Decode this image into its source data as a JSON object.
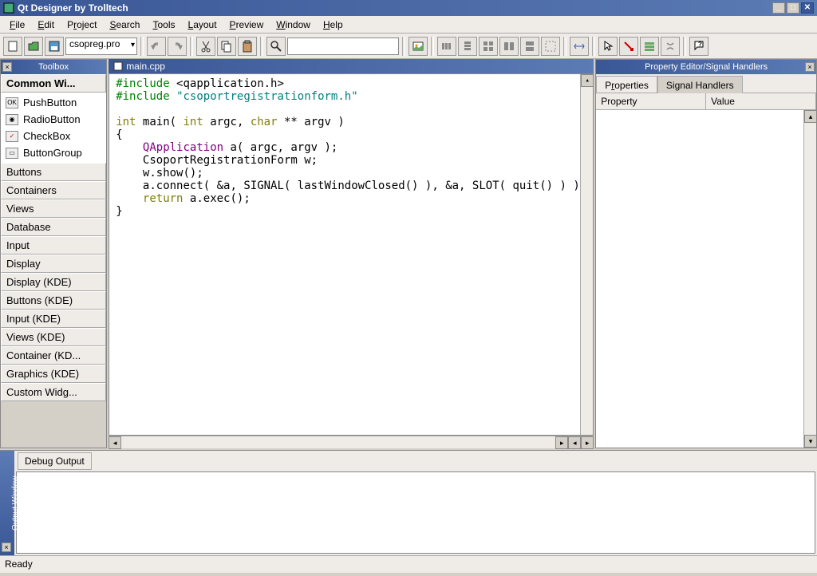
{
  "window": {
    "title": "Qt Designer by Trolltech"
  },
  "menu": {
    "file": "File",
    "edit": "Edit",
    "project": "Project",
    "search": "Search",
    "tools": "Tools",
    "layout": "Layout",
    "preview": "Preview",
    "window": "Window",
    "help": "Help"
  },
  "toolbar": {
    "project_combo": "csopreg.pro"
  },
  "toolbox": {
    "title": "Toolbox",
    "active_section": "Common Wi...",
    "items": [
      {
        "label": "PushButton",
        "icon": "ok"
      },
      {
        "label": "RadioButton",
        "icon": "radio"
      },
      {
        "label": "CheckBox",
        "icon": "check"
      },
      {
        "label": "ButtonGroup",
        "icon": "group"
      }
    ],
    "sections": [
      "Buttons",
      "Containers",
      "Views",
      "Database",
      "Input",
      "Display",
      "Display (KDE)",
      "Buttons (KDE)",
      "Input (KDE)",
      "Views (KDE)",
      "Container (KD...",
      "Graphics (KDE)",
      "Custom Widg..."
    ]
  },
  "editor": {
    "tab_title": "main.cpp",
    "code_lines": [
      {
        "t": "#include",
        "c": "kw-green",
        "r": " <qapplication.h>"
      },
      {
        "t": "#include",
        "c": "kw-green",
        "r": " ",
        "s": "\"csoportregistrationform.h\"",
        "sc": "str-teal"
      },
      {
        "blank": true
      },
      {
        "parts": [
          {
            "t": "int",
            "c": "kw-olive"
          },
          {
            "t": " main( "
          },
          {
            "t": "int",
            "c": "kw-olive"
          },
          {
            "t": " argc, "
          },
          {
            "t": "char",
            "c": "kw-olive"
          },
          {
            "t": " ** argv )"
          }
        ]
      },
      {
        "t": "{"
      },
      {
        "parts": [
          {
            "t": "    "
          },
          {
            "t": "QApplication",
            "c": "kw-purple"
          },
          {
            "t": " a( argc, argv );"
          }
        ]
      },
      {
        "t": "    CsoportRegistrationForm w;"
      },
      {
        "t": "    w.show();"
      },
      {
        "t": "    a.connect( &a, SIGNAL( lastWindowClosed() ), &a, SLOT( quit() ) );"
      },
      {
        "parts": [
          {
            "t": "    "
          },
          {
            "t": "return",
            "c": "kw-olive"
          },
          {
            "t": " a.exec();"
          }
        ]
      },
      {
        "t": "}"
      }
    ]
  },
  "properties": {
    "title": "Property Editor/Signal Handlers",
    "tabs": {
      "properties": "Properties",
      "signal": "Signal Handlers"
    },
    "col1": "Property",
    "col2": "Value"
  },
  "output": {
    "side_label": "Output Window",
    "tab": "Debug Output"
  },
  "status": {
    "text": "Ready"
  }
}
